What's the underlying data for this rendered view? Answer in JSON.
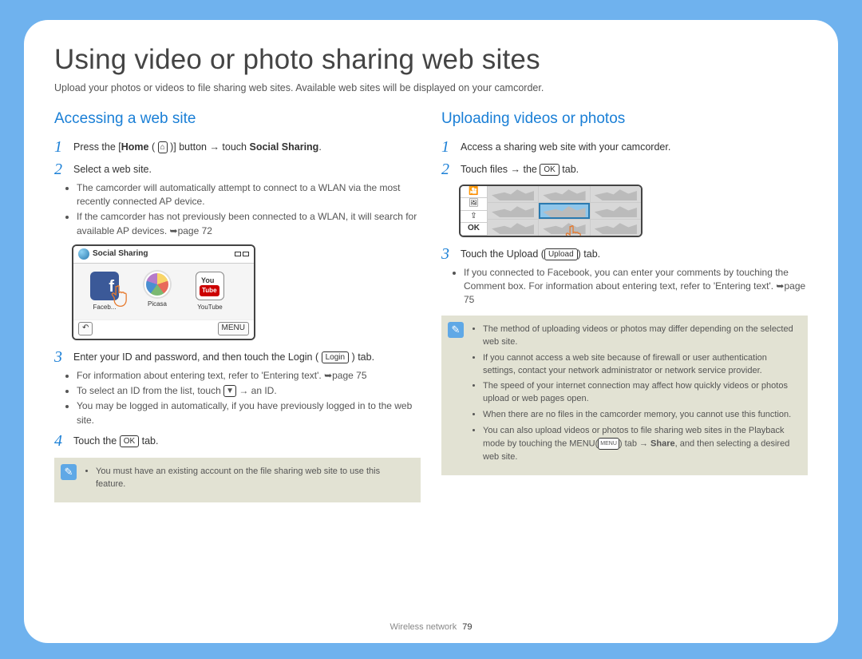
{
  "title": "Using video or photo sharing web sites",
  "intro": "Upload your photos or videos to file sharing web sites. Available web sites will be displayed on your camcorder.",
  "left": {
    "heading": "Accessing a web site",
    "s1a": "Press the [",
    "s1b": "Home",
    "s1c": " ( ",
    "s1d": " )] button → touch ",
    "s1e": "Social Sharing",
    "s1f": ".",
    "s2": "Select a web site.",
    "s2b1": "The camcorder will automatically attempt to connect to a WLAN via the most recently connected AP device.",
    "s2b2": "If the camcorder has not previously been connected to a WLAN, it will search for available AP devices. ➥page 72",
    "ss_title": "Social Sharing",
    "apps": {
      "fb": "Faceb...",
      "picasa": "Picasa",
      "yt": "YouTube"
    },
    "back": "↶",
    "menu": "MENU",
    "s3a": "Enter your ID and password, and then touch the Login (",
    "s3b": ") tab.",
    "login_label": "Login",
    "s3b1": "For information about entering text, refer to 'Entering text'. ➥page 75",
    "s3b2a": "To select an ID from the list, touch ",
    "s3b2b": " → an ID.",
    "s3b3": "You may be logged in automatically, if you have previously logged in to the web site.",
    "s4a": "Touch the ",
    "s4b": " tab.",
    "ok_label": "OK",
    "note": "You must have an existing account on the file sharing web site to use this feature."
  },
  "right": {
    "heading": "Uploading videos or photos",
    "s1": "Access a sharing web site with your camcorder.",
    "s2a": "Touch files → the ",
    "s2b": " tab.",
    "ok_label": "OK",
    "side_ok": "OK",
    "s3a": "Touch the Upload (",
    "s3b": ") tab.",
    "upload_label": "Upload",
    "s3b1": "If you connected to Facebook, you can enter your comments by touching the Comment box. For information about entering text, refer to 'Entering text'. ➥page 75",
    "notes": {
      "n1": "The method of uploading videos or photos may differ depending on the selected web site.",
      "n2": "If you cannot access a web site because of firewall or user authentication settings, contact your network administrator or network service provider.",
      "n3": "The speed of your internet connection may affect how quickly videos or photos upload or web pages open.",
      "n4": "When there are no files in the camcorder memory, you cannot use this function.",
      "n5a": "You can also upload videos or photos to file sharing web sites in the Playback mode by touching the MENU(",
      "n5b": ") tab → ",
      "n5c": "Share",
      "n5d": ", and then selecting a desired web site.",
      "menu_small": "MENU"
    }
  },
  "footer": {
    "section": "Wireless network",
    "page": "79"
  },
  "nums": {
    "n1": "1",
    "n2": "2",
    "n3": "3",
    "n4": "4"
  }
}
